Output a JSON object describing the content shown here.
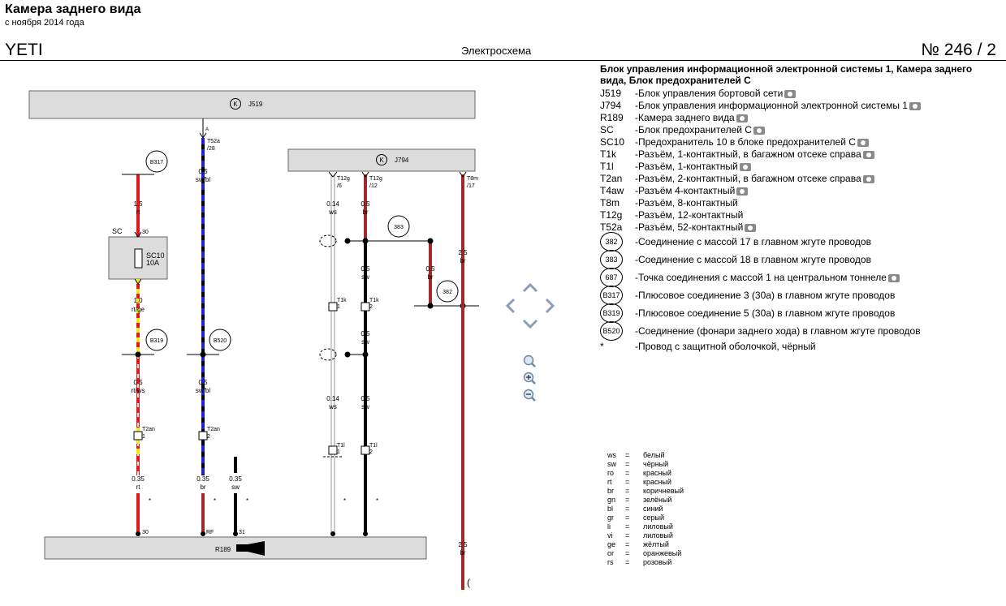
{
  "header": {
    "title": "Камера заднего вида",
    "subtitle": "с ноября 2014 года",
    "model": "YETI",
    "center_title": "Электросхема",
    "doc_number": "№  246 / 2"
  },
  "legend": {
    "heading": "Блок управления информационной электронной системы 1, Камера заднего вида, Блок предохранителей C",
    "components": [
      {
        "code": "J519",
        "desc": "-Блок управления бортовой сети",
        "camera": true
      },
      {
        "code": "J794",
        "desc": "-Блок управления информационной электронной системы 1",
        "camera": true
      },
      {
        "code": "R189",
        "desc": "-Камера заднего вида",
        "camera": true
      },
      {
        "code": "SC",
        "desc": "-Блок предохранителей C",
        "camera": true
      },
      {
        "code": "SC10",
        "desc": "-Предохранитель 10 в блоке предохранителей C",
        "camera": true
      },
      {
        "code": "T1k",
        "desc": "-Разъём, 1-контактный, в багажном отсеке справа",
        "camera": true
      },
      {
        "code": "T1l",
        "desc": "-Разъём, 1-контактный",
        "camera": true
      },
      {
        "code": "T2an",
        "desc": "-Разъём, 2-контактный, в багажном отсеке справа",
        "camera": true
      },
      {
        "code": "T4aw",
        "desc": "-Разъём 4-контактный",
        "camera": true
      },
      {
        "code": "T8m",
        "desc": "-Разъём, 8-контактный",
        "camera": false
      },
      {
        "code": "T12g",
        "desc": "-Разъём, 12-контактный",
        "camera": false
      },
      {
        "code": "T52a",
        "desc": "-Разъём, 52-контактный",
        "camera": true
      }
    ],
    "points": [
      {
        "code": "382",
        "desc": "-Соединение с массой 17 в главном жгуте проводов",
        "camera": false
      },
      {
        "code": "383",
        "desc": "-Соединение с массой 18 в главном жгуте проводов",
        "camera": false
      },
      {
        "code": "687",
        "desc": "-Точка соединения с массой 1 на центральном тоннеле",
        "camera": true
      },
      {
        "code": "B317",
        "desc": "-Плюсовое соединение 3 (30a) в главном жгуте проводов",
        "camera": false
      },
      {
        "code": "B319",
        "desc": "-Плюсовое соединение 5 (30a) в главном жгуте проводов",
        "camera": false
      },
      {
        "code": "B520",
        "desc": "-Соединение (фонари заднего хода) в главном жгуте проводов",
        "camera": false
      }
    ],
    "footnote": {
      "code": "*",
      "desc": "-Провод с защитной оболочкой, чёрный"
    }
  },
  "color_codes": [
    {
      "code": "ws",
      "name": "белый"
    },
    {
      "code": "sw",
      "name": "чёрный"
    },
    {
      "code": "ro",
      "name": "красный"
    },
    {
      "code": "rt",
      "name": "красный"
    },
    {
      "code": "br",
      "name": "коричневый"
    },
    {
      "code": "gn",
      "name": "зелёный"
    },
    {
      "code": "bl",
      "name": "синий"
    },
    {
      "code": "gr",
      "name": "серый"
    },
    {
      "code": "li",
      "name": "лиловый"
    },
    {
      "code": "vi",
      "name": "лиловый"
    },
    {
      "code": "ge",
      "name": "жёлтый"
    },
    {
      "code": "or",
      "name": "оранжевый"
    },
    {
      "code": "rs",
      "name": "розовый"
    }
  ],
  "diagram": {
    "components": {
      "J519": "J519",
      "J794": "J794",
      "R189": "R189",
      "SC": "SC",
      "SC10": "SC10",
      "SC10_rating": "10A",
      "K": "K"
    },
    "connectors": {
      "T52a": "T52a",
      "T52a_pin": "/28",
      "T52a_a": "A",
      "T12g_6": "T12g",
      "T12g_6_pin": "/6",
      "T12g_12": "T12g",
      "T12g_12_pin": "/12",
      "T8m": "T8m",
      "T8m_pin": "/17",
      "T1k_a": "T1k",
      "T1k_a_pin": "1",
      "T1k_b": "T1k",
      "T1k_b_pin": "2",
      "T2an_a": "T2an",
      "T2an_a_pin": "1",
      "T2an_b": "T2an",
      "T2an_b_pin": "2",
      "T1l_a": "T1l",
      "T1l_a_pin": "1",
      "T1l_b": "T1l",
      "T1l_b_pin": "2",
      "sc_pin30": "30",
      "r189_pin30": "30",
      "r189_pinRF": "RF",
      "r189_pin31": "31"
    },
    "circles": {
      "B317": "B317",
      "B319": "B319",
      "B520": "B520",
      "383": "383",
      "382": "382"
    },
    "wires": {
      "w1_size": "1.5",
      "w1_color": "rt",
      "w2_size": "1.0",
      "w2_color": "rt/ge",
      "w3_size": "0.5",
      "w3_color": "rt/ws",
      "w4_size": "0.35",
      "w4_color": "rt",
      "w5_size": "0.5",
      "w5_color": "sw/bl",
      "w6_size": "0.5",
      "w6_color": "sw/bl",
      "w7_size": "0.35",
      "w7_color": "br",
      "w8_size": "0.35",
      "w8_color": "sw",
      "w9_size": "0.14",
      "w9_color": "ws",
      "w10_size": "0.14",
      "w10_color": "ws",
      "w11_size": "0.5",
      "w11_color": "br",
      "w12_size": "0.5",
      "w12_color": "sw",
      "w13_size": "0.5",
      "w13_color": "sw",
      "w14_size": "0.5",
      "w14_color": "sw",
      "w15_size": "0.5",
      "w15_color": "br",
      "w16_size": "2.5",
      "w16_color": "br",
      "w17_size": "2.5",
      "w17_color": "br",
      "star": "*"
    }
  },
  "palette": {
    "red": "#e4161c",
    "brown": "#9e2a2b",
    "blue": "#1e22c8",
    "yellow": "#f3e81a",
    "black": "#000000",
    "white": "#ffffff",
    "panel": "#dcdcdc"
  }
}
